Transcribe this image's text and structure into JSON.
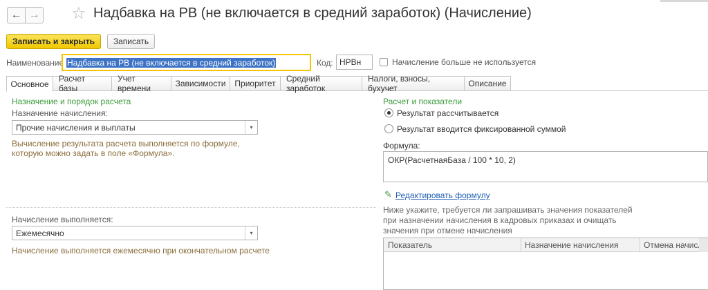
{
  "window": {
    "title": "Надбавка на РВ (не включается в средний заработок) (Начисление)"
  },
  "nav": {
    "back_glyph": "←",
    "forward_glyph": "→",
    "favorite_glyph": "☆"
  },
  "toolbar": {
    "save_close_label": "Записать и закрыть",
    "save_label": "Записать"
  },
  "fields": {
    "name_label": "Наименование:",
    "name_value": "Надбавка на РВ (не включается в средний заработок)",
    "code_label": "Код:",
    "code_value": "НРВн",
    "not_used_label": "Начисление больше не используется"
  },
  "tabs": [
    {
      "label": "Основное",
      "active": true
    },
    {
      "label": "Расчет базы"
    },
    {
      "label": "Учет времени"
    },
    {
      "label": "Зависимости"
    },
    {
      "label": "Приоритет"
    },
    {
      "label": "Средний заработок"
    },
    {
      "label": "Налоги, взносы, бухучет"
    },
    {
      "label": "Описание"
    }
  ],
  "left": {
    "group_title": "Назначение и порядок расчета",
    "purpose_label": "Назначение начисления:",
    "purpose_value": "Прочие начисления и выплаты",
    "purpose_hint_1": "Вычисление результата расчета выполняется по формуле,",
    "purpose_hint_2": "которую можно задать в поле «Формула».",
    "period_label": "Начисление выполняется:",
    "period_value": "Ежемесячно",
    "period_hint": "Начисление выполняется ежемесячно при окончательном расчете"
  },
  "right": {
    "group_title": "Расчет и показатели",
    "radio_calculated": "Результат рассчитывается",
    "radio_fixed": "Результат вводится фиксированной суммой",
    "formula_label": "Формула:",
    "formula_value": "ОКР(РасчетнаяБаза / 100 * 10, 2)",
    "edit_formula_link": "Редактировать формулу",
    "indicators_hint_1": "Ниже укажите, требуется ли запрашивать значения показателей",
    "indicators_hint_2": "при назначении начисления в кадровых приказах и очищать",
    "indicators_hint_3": "значения при отмене начисления",
    "table_headers": [
      "Показатель",
      "Назначение начисления",
      "Отмена начислени"
    ]
  },
  "icons": {
    "combo_arrow": "▾",
    "pencil": "✎"
  }
}
